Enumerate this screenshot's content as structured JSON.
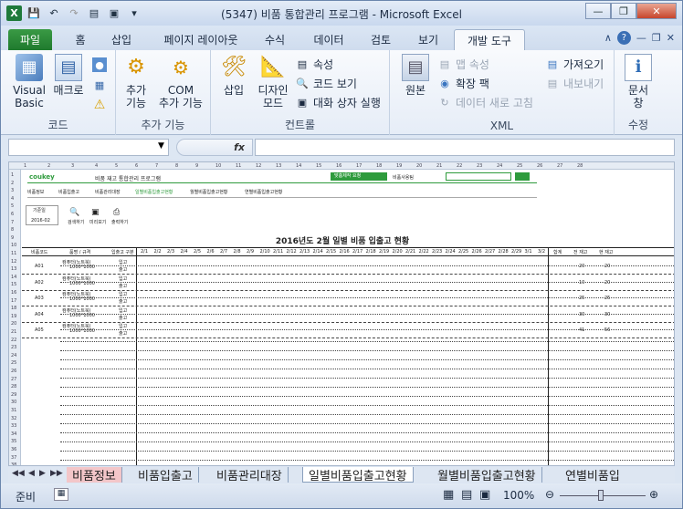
{
  "window": {
    "title": "(5347) 비품 통합관리 프로그램  -  Microsoft Excel",
    "logo": "X"
  },
  "ribbon_tabs": [
    "파일",
    "홈",
    "삽입",
    "페이지 레이아웃",
    "수식",
    "데이터",
    "검토",
    "보기",
    "개발 도구"
  ],
  "groups": {
    "code": {
      "label": "코드",
      "visual_basic": "Visual\nBasic",
      "macro": "매크로"
    },
    "addins": {
      "label": "추가 기능",
      "addin": "추가\n기능",
      "com": "COM\n추가 기능"
    },
    "controls": {
      "label": "컨트롤",
      "insert": "삽입",
      "design": "디자인\n모드",
      "properties": "속성",
      "view_code": "코드 보기",
      "dialog": "대화 상자 실행"
    },
    "xml": {
      "label": "XML",
      "source": "원본",
      "map_props": "맵 속성",
      "expansion": "확장 팩",
      "refresh": "데이터 새로 고침",
      "import": "가져오기",
      "export": "내보내기"
    },
    "modify": {
      "label": "수정",
      "doc_pane": "문서\n창"
    }
  },
  "formula": {
    "fx": "fx",
    "name": "",
    "value": ""
  },
  "sheet": {
    "columns": [
      "1",
      "2",
      "3",
      "4",
      "5",
      "6",
      "7",
      "8",
      "9",
      "10",
      "11",
      "12",
      "13",
      "14",
      "15",
      "16",
      "17",
      "18",
      "19",
      "20",
      "21",
      "22",
      "23",
      "24",
      "25",
      "26",
      "27",
      "28"
    ],
    "rows": [
      "1",
      "2",
      "3",
      "4",
      "5",
      "6",
      "7",
      "8",
      "9",
      "10",
      "11",
      "12",
      "13",
      "14",
      "15",
      "16",
      "17",
      "18",
      "19",
      "20",
      "21",
      "22",
      "23",
      "24",
      "25",
      "26",
      "27",
      "28",
      "29",
      "30",
      "31",
      "32",
      "33",
      "34",
      "35",
      "36",
      "37",
      "38"
    ],
    "brand": "coukey",
    "app_name": "비품 재고 통합관리 프로그램",
    "btn1": "맞춤제작 요청",
    "user": "비품사용팀",
    "menu": [
      "비품정보",
      "비품입출고",
      "비품관리대장",
      "일별비품입출고현황",
      "월별비품입출고현황",
      "연별비품입출고현황"
    ],
    "period_label": "기준일",
    "period": "2016-02",
    "actions": [
      "검색하기",
      "미리보기",
      "출력하기"
    ],
    "report_title": "2016년도 2월 일별 비품 입출고 현황",
    "header": [
      "비품코드",
      "품명 / 규격",
      "입출고 구분"
    ],
    "dates": [
      "2/1",
      "2/2",
      "2/3",
      "2/4",
      "2/5",
      "2/6",
      "2/7",
      "2/8",
      "2/9",
      "2/10",
      "2/11",
      "2/12",
      "2/13",
      "2/14",
      "2/15",
      "2/16",
      "2/17",
      "2/18",
      "2/19",
      "2/20",
      "2/21",
      "2/22",
      "2/23",
      "2/24",
      "2/25",
      "2/26",
      "2/27",
      "2/28",
      "2/29",
      "3/1",
      "3/2"
    ],
    "sum_headers": [
      "합계",
      "전 재고",
      "현 재고"
    ],
    "items": [
      {
        "code": "A01",
        "name": "컴퓨터(노트북)",
        "spec": "1000*1000",
        "prev": "20",
        "cur": "20"
      },
      {
        "code": "A02",
        "name": "컴퓨터(노트북)",
        "spec": "1000*1000",
        "prev": "10",
        "cur": "20"
      },
      {
        "code": "A03",
        "name": "컴퓨터(노트북)",
        "spec": "1000*1000",
        "prev": "25",
        "cur": "25"
      },
      {
        "code": "A04",
        "name": "컴퓨터(노트북)",
        "spec": "1000*1000",
        "prev": "30",
        "cur": "30"
      },
      {
        "code": "A05",
        "name": "컴퓨터(노트북)",
        "spec": "1000*1000",
        "prev": "41",
        "cur": "56"
      }
    ],
    "io": [
      "입고",
      "출고"
    ]
  },
  "sheet_tabs": [
    "비품정보",
    "비품입출고",
    "비품관리대장",
    "일별비품입출고현황",
    "월별비품입출고현황",
    "연별비품입"
  ],
  "status": {
    "ready": "준비",
    "zoom": "100%"
  }
}
